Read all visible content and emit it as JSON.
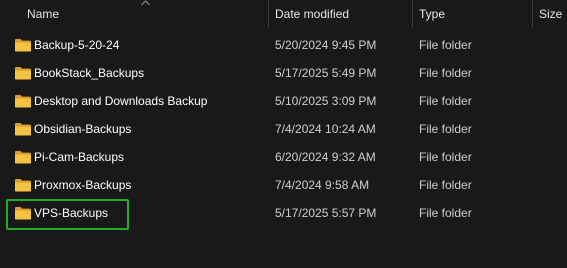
{
  "columns": {
    "name": "Name",
    "date_modified": "Date modified",
    "type": "Type",
    "size": "Size"
  },
  "sort": {
    "column": "name",
    "icon": "chevron-up-icon"
  },
  "files": [
    {
      "name": "Backup-5-20-24",
      "date_modified": "5/20/2024 9:45 PM",
      "type": "File folder",
      "icon": "folder-icon"
    },
    {
      "name": "BookStack_Backups",
      "date_modified": "5/17/2025 5:49 PM",
      "type": "File folder",
      "icon": "folder-icon"
    },
    {
      "name": "Desktop and Downloads Backup",
      "date_modified": "5/10/2025 3:09 PM",
      "type": "File folder",
      "icon": "folder-icon"
    },
    {
      "name": "Obsidian-Backups",
      "date_modified": "7/4/2024 10:24 AM",
      "type": "File folder",
      "icon": "folder-icon"
    },
    {
      "name": "Pi-Cam-Backups",
      "date_modified": "6/20/2024 9:32 AM",
      "type": "File folder",
      "icon": "folder-icon"
    },
    {
      "name": "Proxmox-Backups",
      "date_modified": "7/4/2024 9:58 AM",
      "type": "File folder",
      "icon": "folder-icon"
    },
    {
      "name": "VPS-Backups",
      "date_modified": "5/17/2025 5:57 PM",
      "type": "File folder",
      "icon": "folder-icon",
      "highlighted": true
    }
  ],
  "colors": {
    "background": "#191919",
    "folder_yellow": "#f5c242",
    "highlight_green": "#1fae2a"
  }
}
